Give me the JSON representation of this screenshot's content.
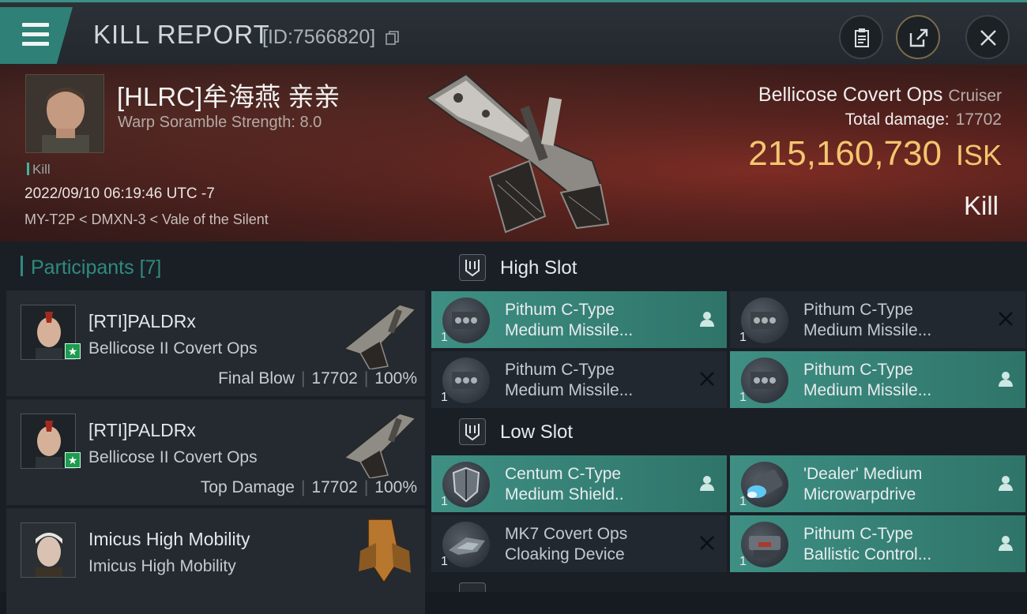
{
  "header": {
    "title": "KILL REPORT",
    "report_id": "[ID:7566820]"
  },
  "victim": {
    "name": "[HLRC]牟海燕 亲亲",
    "scramble": "Warp Soramble Strength: 8.0",
    "tag": "Kill",
    "timestamp": "2022/09/10 06:19:46 UTC -7",
    "location": "MY-T2P < DMXN-3 < Vale of the Silent",
    "ship": "Bellicose Covert Ops",
    "ship_class": "Cruiser",
    "damage_label": "Total damage:",
    "damage_value": "17702",
    "isk_value": "215,160,730",
    "isk_unit": "ISK",
    "result": "Kill"
  },
  "participants": {
    "label": "Participants",
    "count": "[7]",
    "items": [
      {
        "name": "[RTI]PALDRx",
        "ship": "Bellicose II Covert Ops",
        "role": "Final Blow",
        "damage": "17702",
        "percent": "100%"
      },
      {
        "name": "[RTI]PALDRx",
        "ship": "Bellicose II Covert Ops",
        "role": "Top Damage",
        "damage": "17702",
        "percent": "100%"
      },
      {
        "name": "Imicus High Mobility",
        "ship": "Imicus High Mobility"
      }
    ]
  },
  "fitting": {
    "high_slot": {
      "label": "High Slot",
      "modules": [
        {
          "line1": "Pithum C-Type",
          "line2": "Medium Missile...",
          "qty": "1",
          "state": "dropped",
          "icon": "missile-launcher-icon"
        },
        {
          "line1": "Pithum C-Type",
          "line2": "Medium Missile...",
          "qty": "1",
          "state": "destroyed",
          "icon": "missile-launcher-icon"
        },
        {
          "line1": "Pithum C-Type",
          "line2": "Medium Missile...",
          "qty": "1",
          "state": "destroyed",
          "icon": "missile-launcher-icon"
        },
        {
          "line1": "Pithum C-Type",
          "line2": "Medium Missile...",
          "qty": "1",
          "state": "dropped",
          "icon": "missile-launcher-icon"
        }
      ]
    },
    "low_slot": {
      "label": "Low Slot",
      "modules": [
        {
          "line1": "Centum C-Type",
          "line2": "Medium Shield..",
          "qty": "1",
          "state": "dropped",
          "icon": "shield-icon"
        },
        {
          "line1": "'Dealer' Medium",
          "line2": "Microwarpdrive",
          "qty": "1",
          "state": "dropped",
          "icon": "microwarpdrive-icon"
        },
        {
          "line1": "MK7 Covert Ops",
          "line2": "Cloaking Device",
          "qty": "1",
          "state": "destroyed",
          "icon": "cloak-icon"
        },
        {
          "line1": "Pithum C-Type",
          "line2": "Ballistic Control...",
          "qty": "1",
          "state": "dropped",
          "icon": "ballistic-control-icon"
        }
      ]
    }
  },
  "colors": {
    "accent": "#2f8076",
    "isk": "#f3c66f",
    "module_dropped": "#3e8f84",
    "module_destroyed": "#222830"
  }
}
